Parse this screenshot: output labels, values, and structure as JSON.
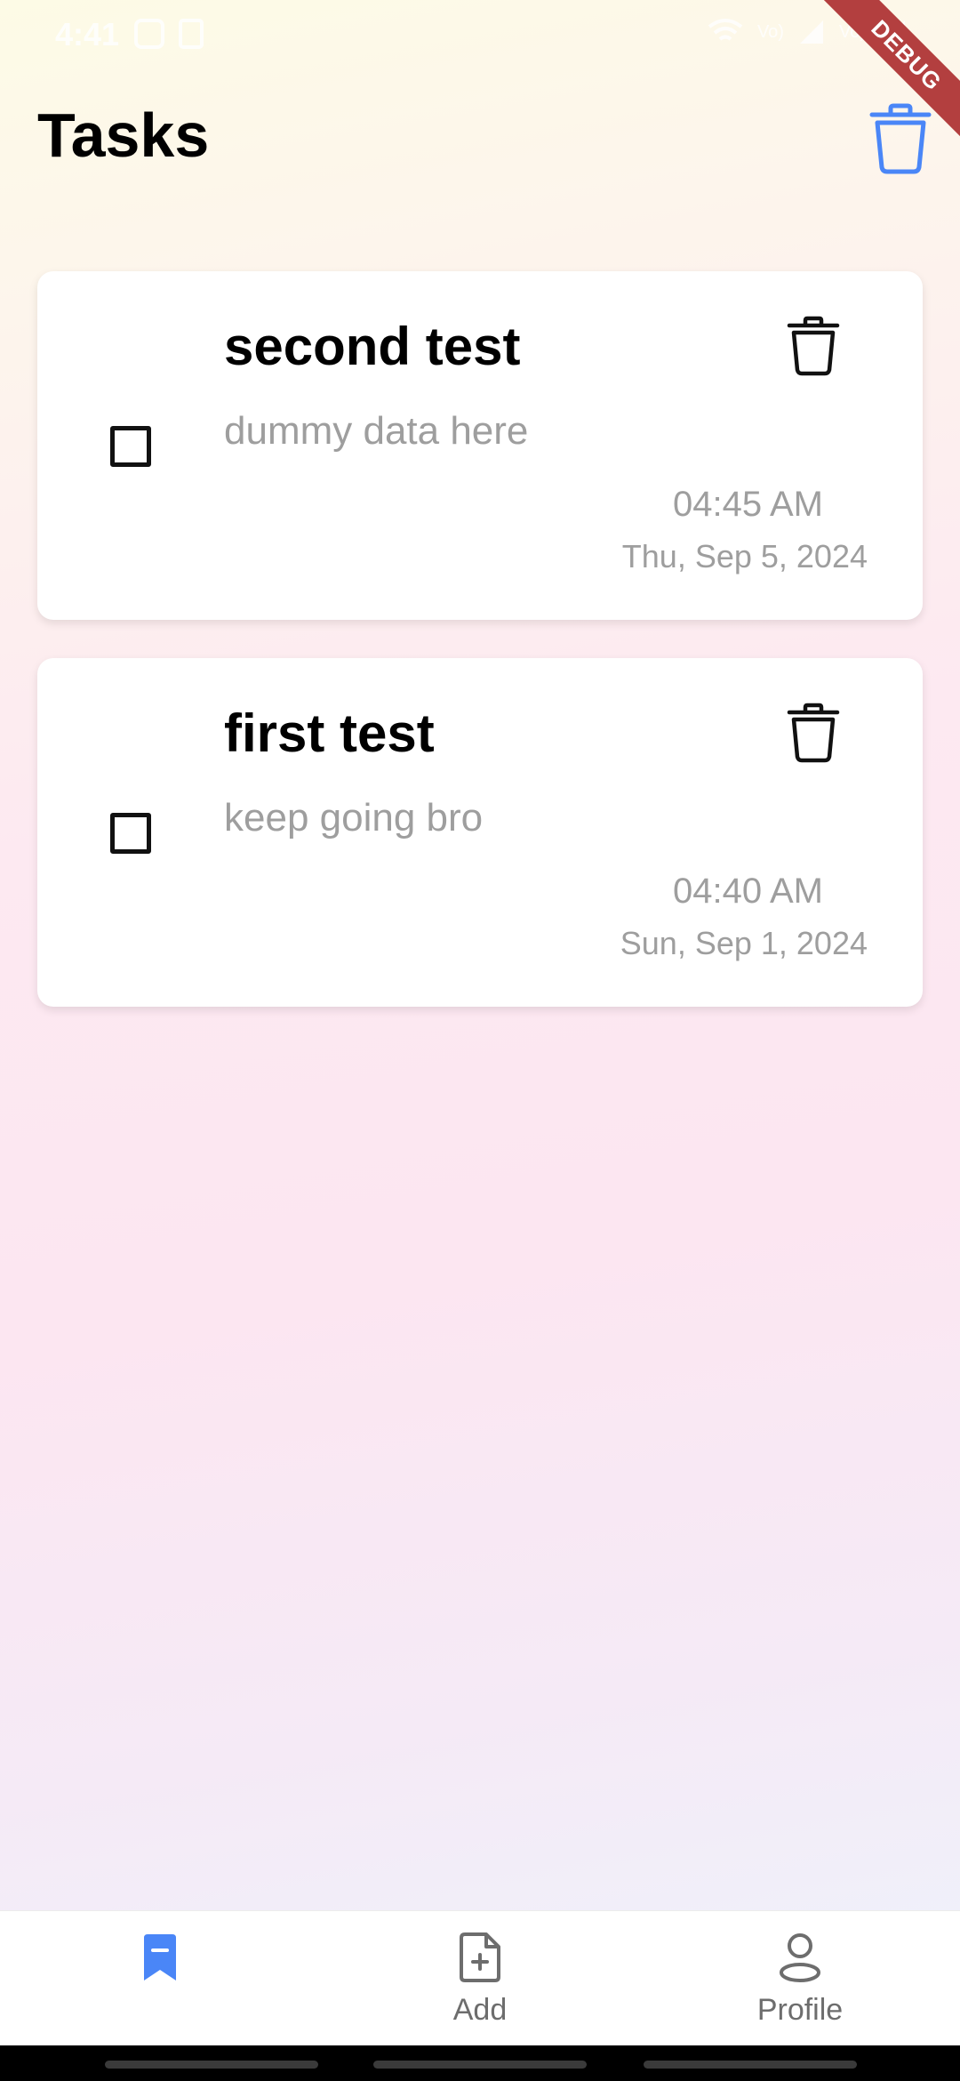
{
  "status_bar": {
    "time": "4:41",
    "network_labels": [
      "Vo)",
      "Vo)"
    ]
  },
  "debug_banner": {
    "label": "DEBUG"
  },
  "header": {
    "title": "Tasks",
    "clear_icon": "trash-icon"
  },
  "tasks": [
    {
      "title": "second test",
      "description": "dummy data here",
      "time": "04:45 AM",
      "date": "Thu, Sep 5, 2024",
      "checked": false
    },
    {
      "title": "first test",
      "description": "keep going bro",
      "time": "04:40 AM",
      "date": "Sun, Sep 1, 2024",
      "checked": false
    }
  ],
  "bottom_nav": {
    "items": [
      {
        "label": "",
        "icon": "bookmark-icon",
        "active": true
      },
      {
        "label": "Add",
        "icon": "add-file-icon",
        "active": false
      },
      {
        "label": "Profile",
        "icon": "user-icon",
        "active": false
      }
    ]
  },
  "colors": {
    "accent": "#4a86f7",
    "muted_text": "#9e9e9e",
    "debug_ribbon": "#b33f3f"
  }
}
